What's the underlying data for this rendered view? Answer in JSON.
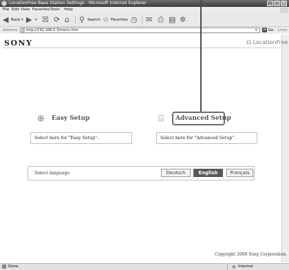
{
  "window": {
    "title": "LocationFree Base Station Settings - Microsoft Internet Explorer"
  },
  "menu": [
    "File",
    "Edit",
    "View",
    "Favorites",
    "Tools",
    "Help"
  ],
  "toolbar": {
    "back_label": "Back",
    "search_label": "Search",
    "favorites_label": "Favorites"
  },
  "address": {
    "label": "Address",
    "url": "http://192.168.0.3/menu.htm",
    "go_label": "Go",
    "links_label": "Links"
  },
  "page": {
    "brand": "SONY",
    "product_logo": "LocationFree",
    "easy_setup": {
      "title": "Easy Setup",
      "description": "Select here for \"Easy Setup\"."
    },
    "advanced_setup": {
      "title": "Advanced Setup",
      "description": "Select here for \"Advanced Setup\"."
    },
    "language": {
      "label": "Select language",
      "options": [
        "Deutsch",
        "English",
        "Français"
      ],
      "selected": "English"
    },
    "copyright": "Copyright 2006 Sony Corporation."
  },
  "status": {
    "text": "Done",
    "zone": "Internet"
  }
}
